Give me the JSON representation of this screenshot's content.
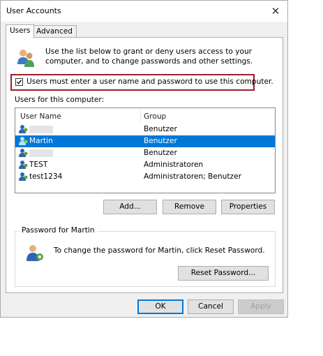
{
  "window": {
    "title": "User Accounts",
    "close_glyph": "✕"
  },
  "tabs": [
    {
      "label": "Users",
      "active": true
    },
    {
      "label": "Advanced",
      "active": false
    }
  ],
  "intro_text": "Use the list below to grant or deny users access to your computer, and to change passwords and other settings.",
  "require_login": {
    "checked": true,
    "label": "Users must enter a user name and password to use this computer."
  },
  "users_list": {
    "caption": "Users for this computer:",
    "columns": [
      "User Name",
      "Group"
    ],
    "rows": [
      {
        "name": "",
        "group": "Benutzer",
        "redacted": true
      },
      {
        "name": "Martin",
        "group": "Benutzer",
        "selected": true
      },
      {
        "name": "",
        "group": "Benutzer",
        "redacted": true
      },
      {
        "name": "TEST",
        "group": "Administratoren"
      },
      {
        "name": "test1234",
        "group": "Administratoren; Benutzer"
      }
    ]
  },
  "list_buttons": {
    "add": "Add...",
    "remove": "Remove",
    "properties": "Properties"
  },
  "password_group": {
    "title": "Password for Martin",
    "text": "To change the password for Martin, click Reset Password.",
    "reset_button": "Reset Password..."
  },
  "footer": {
    "ok": "OK",
    "cancel": "Cancel",
    "apply": "Apply",
    "apply_disabled": true
  },
  "colors": {
    "selection": "#0078d7",
    "highlight_frame": "#9a1f2e",
    "dialog_bg": "#f0f0f0"
  }
}
